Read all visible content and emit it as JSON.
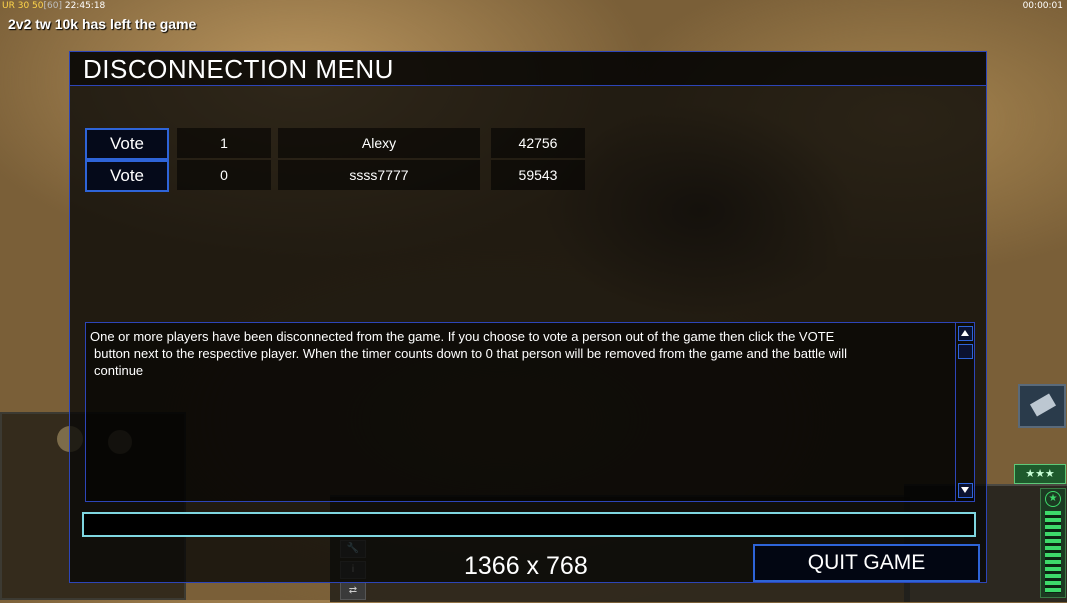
{
  "hud": {
    "ur_label": "UR",
    "fps_value": "30",
    "fps_current": "50",
    "fps_cap": "[60]",
    "local_time": "22:45:18",
    "game_timer": "00:00:01"
  },
  "notice": "2v2 tw 10k has left the game",
  "dialog": {
    "title": "DISCONNECTION MENU",
    "players": [
      {
        "vote_label": "Vote",
        "votes": "1",
        "name": "Alexy",
        "ping": "42756"
      },
      {
        "vote_label": "Vote",
        "votes": "0",
        "name": "ssss7777",
        "ping": "59543"
      }
    ],
    "message_lines": [
      "One or more players have been disconnected from the game. If you choose to vote a person out of the game then click the VOTE",
      "button next to the respective player. When the timer counts down to 0 that person will be removed from the game and the battle will",
      "continue"
    ],
    "chat_value": "",
    "timer_text": "1366 x 768",
    "quit_label": "QUIT GAME"
  },
  "game_ui": {
    "rank_stars": "★★★",
    "power_star": "★",
    "side_icons": [
      "🔧",
      "i",
      "⇄"
    ]
  },
  "colors": {
    "dialog_border": "#2d45b8",
    "button_border": "#2e64d8",
    "chat_border": "#7fd6e0",
    "power_green": "#3dd96a"
  }
}
